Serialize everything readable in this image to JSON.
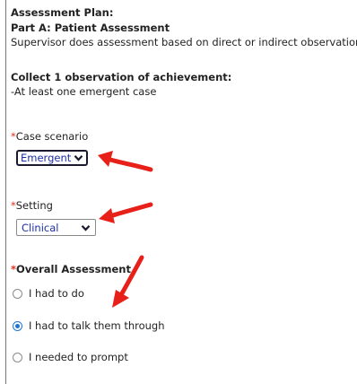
{
  "assessment_plan": {
    "heading": "Assessment Plan:",
    "part_title": "Part A: Patient Assessment",
    "description": "Supervisor does assessment based on direct or indirect observation"
  },
  "requirements": {
    "heading": "Collect 1 observation of achievement:",
    "item": "-At least one emergent case"
  },
  "fields": {
    "required_marker": "*",
    "case_scenario": {
      "label": "Case scenario",
      "selected": "Emergent"
    },
    "setting": {
      "label": "Setting",
      "selected": "Clinical"
    },
    "overall_assessment": {
      "label": "Overall Assessment",
      "options": [
        "I had to do",
        "I had to talk them through",
        "I needed to prompt"
      ],
      "selected_index": 1
    }
  },
  "icons": {
    "select_chevron": "chevron-down-icon",
    "annotation_arrow": "red-arrow-icon"
  },
  "colors": {
    "required": "#e0301e",
    "select_text": "#1c2ea6",
    "radio_selected": "#1f74d6",
    "annotation_arrow": "#e8201a"
  }
}
